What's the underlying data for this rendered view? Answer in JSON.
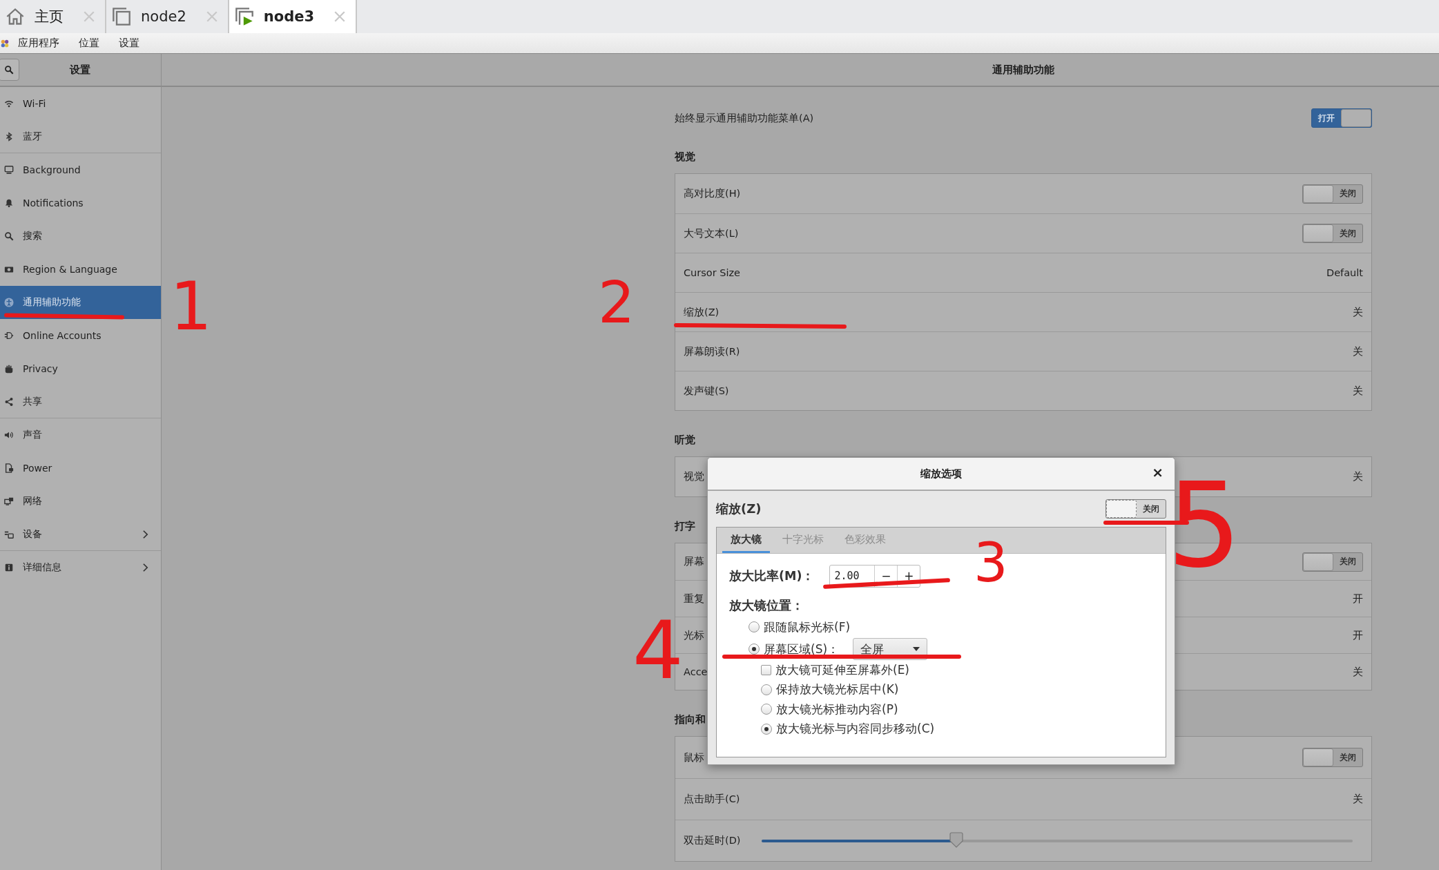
{
  "browser_tabs": [
    {
      "label": "主页",
      "selected": false
    },
    {
      "label": "node2",
      "selected": false
    },
    {
      "label": "node3",
      "selected": true
    }
  ],
  "top_menu": [
    "应用程序",
    "位置",
    "设置"
  ],
  "sidebar": {
    "title": "设置",
    "items": [
      {
        "label": "Wi-Fi",
        "selected": false,
        "group_end": false,
        "submenu": false
      },
      {
        "label": "蓝牙",
        "selected": false,
        "group_end": true,
        "submenu": false
      },
      {
        "label": "Background",
        "selected": false,
        "group_end": false,
        "submenu": false
      },
      {
        "label": "Notifications",
        "selected": false,
        "group_end": false,
        "submenu": false
      },
      {
        "label": "搜索",
        "selected": false,
        "group_end": false,
        "submenu": false
      },
      {
        "label": "Region & Language",
        "selected": false,
        "group_end": false,
        "submenu": false
      },
      {
        "label": "通用辅助功能",
        "selected": true,
        "group_end": false,
        "submenu": false
      },
      {
        "label": "Online Accounts",
        "selected": false,
        "group_end": false,
        "submenu": false
      },
      {
        "label": "Privacy",
        "selected": false,
        "group_end": false,
        "submenu": false
      },
      {
        "label": "共享",
        "selected": false,
        "group_end": true,
        "submenu": false
      },
      {
        "label": "声音",
        "selected": false,
        "group_end": false,
        "submenu": false
      },
      {
        "label": "Power",
        "selected": false,
        "group_end": false,
        "submenu": false
      },
      {
        "label": "网络",
        "selected": false,
        "group_end": false,
        "submenu": false
      },
      {
        "label": "设备",
        "selected": false,
        "group_end": true,
        "submenu": true
      },
      {
        "label": "详细信息",
        "selected": false,
        "group_end": false,
        "submenu": true
      }
    ]
  },
  "main": {
    "title": "通用辅助功能",
    "always_show": {
      "label": "始终显示通用辅助功能菜单(A)",
      "on": true,
      "state_label": "打开"
    },
    "sections": [
      {
        "title": "视觉",
        "rows": [
          {
            "kind": "toggle",
            "label": "高对比度(H)",
            "on": false,
            "state_label": "关闭"
          },
          {
            "kind": "toggle",
            "label": "大号文本(L)",
            "on": false,
            "state_label": "关闭"
          },
          {
            "kind": "value",
            "label": "Cursor Size",
            "value": "Default"
          },
          {
            "kind": "value",
            "label": "缩放(Z)",
            "value": "关"
          },
          {
            "kind": "value",
            "label": "屏幕朗读(R)",
            "value": "关"
          },
          {
            "kind": "value",
            "label": "发声键(S)",
            "value": "关"
          }
        ]
      },
      {
        "title": "听觉",
        "rows": [
          {
            "kind": "value",
            "label": "视觉",
            "value": "关"
          }
        ]
      },
      {
        "title": "打字",
        "rows": [
          {
            "kind": "toggle",
            "label": "屏幕",
            "on": false,
            "state_label": "关闭"
          },
          {
            "kind": "value",
            "label": "重复",
            "value": "开"
          },
          {
            "kind": "value",
            "label": "光标",
            "value": "开"
          },
          {
            "kind": "value",
            "label": "Acce",
            "value": "关"
          }
        ]
      },
      {
        "title": "指向和",
        "rows": [
          {
            "kind": "toggle",
            "label": "鼠标",
            "on": false,
            "state_label": "关闭"
          },
          {
            "kind": "value",
            "label": "点击助手(C)",
            "value": "关"
          },
          {
            "kind": "slider",
            "label": "双击延时(D)",
            "level": 0.33
          }
        ]
      }
    ]
  },
  "dialog": {
    "title": "缩放选项",
    "close": "×",
    "heading": "缩放(Z)",
    "toggle": {
      "on": false,
      "state_label": "关闭"
    },
    "tabs": [
      {
        "label": "放大镜",
        "selected": true
      },
      {
        "label": "十字光标",
        "selected": false
      },
      {
        "label": "色彩效果",
        "selected": false
      }
    ],
    "magnification": {
      "label": "放大比率(M)：",
      "value": "2.00",
      "decrement": "−",
      "increment": "+"
    },
    "position_label": "放大镜位置：",
    "position_options": [
      {
        "label": "跟随鼠标光标(F)",
        "selected": false
      },
      {
        "label": "屏幕区域(S)：",
        "selected": true,
        "dropdown": "全屏"
      }
    ],
    "screen_area_options": [
      {
        "kind": "checkbox",
        "label": "放大镜可延伸至屏幕外(E)",
        "checked": false
      },
      {
        "kind": "radio",
        "label": "保持放大镜光标居中(K)",
        "selected": false
      },
      {
        "kind": "radio",
        "label": "放大镜光标推动内容(P)",
        "selected": false
      },
      {
        "kind": "radio",
        "label": "放大镜光标与内容同步移动(C)",
        "selected": true
      }
    ]
  },
  "annotations": [
    {
      "label": "1"
    },
    {
      "label": "2"
    },
    {
      "label": "3"
    },
    {
      "label": "4"
    },
    {
      "label": "5"
    }
  ]
}
